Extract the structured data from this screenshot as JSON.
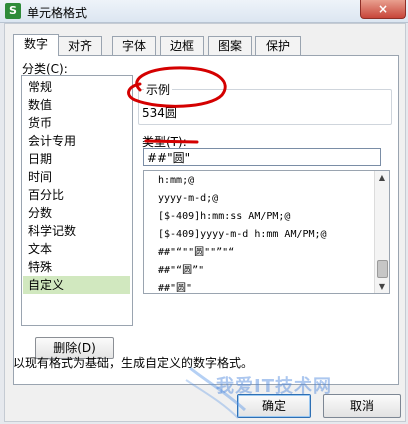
{
  "window": {
    "title": "单元格格式",
    "close_label": "×",
    "icon_letter": "S",
    "icon_color": "#2e8b3a"
  },
  "tabs": [
    {
      "label": "数字",
      "active": true
    },
    {
      "label": "对齐"
    },
    {
      "label": "字体"
    },
    {
      "label": "边框"
    },
    {
      "label": "图案"
    },
    {
      "label": "保护"
    }
  ],
  "category": {
    "label": "分类(C):",
    "items": [
      "常规",
      "数值",
      "货币",
      "会计专用",
      "日期",
      "时间",
      "百分比",
      "分数",
      "科学记数",
      "文本",
      "特殊",
      "自定义"
    ],
    "selected": "自定义",
    "selected_color": "#d1e8bf"
  },
  "delete_button": "删除(D)",
  "sample": {
    "title": "示例",
    "value": "534圆"
  },
  "type": {
    "label": "类型(T):",
    "value": "##\"圆\"",
    "options": [
      "h:mm;@",
      "yyyy-m-d;@",
      "[$-409]h:mm:ss AM/PM;@",
      "[$-409]yyyy-m-d h:mm AM/PM;@",
      "##\"“\"\"圆\"\"”\"“",
      "##\"“圆”\"",
      "##\"圆\""
    ]
  },
  "description": "以现有格式为基础，生成自定义的数字格式。",
  "buttons": {
    "ok": "确定",
    "cancel": "取消"
  },
  "annotation_color": "#d40000",
  "watermark": "我爱IT技术网"
}
